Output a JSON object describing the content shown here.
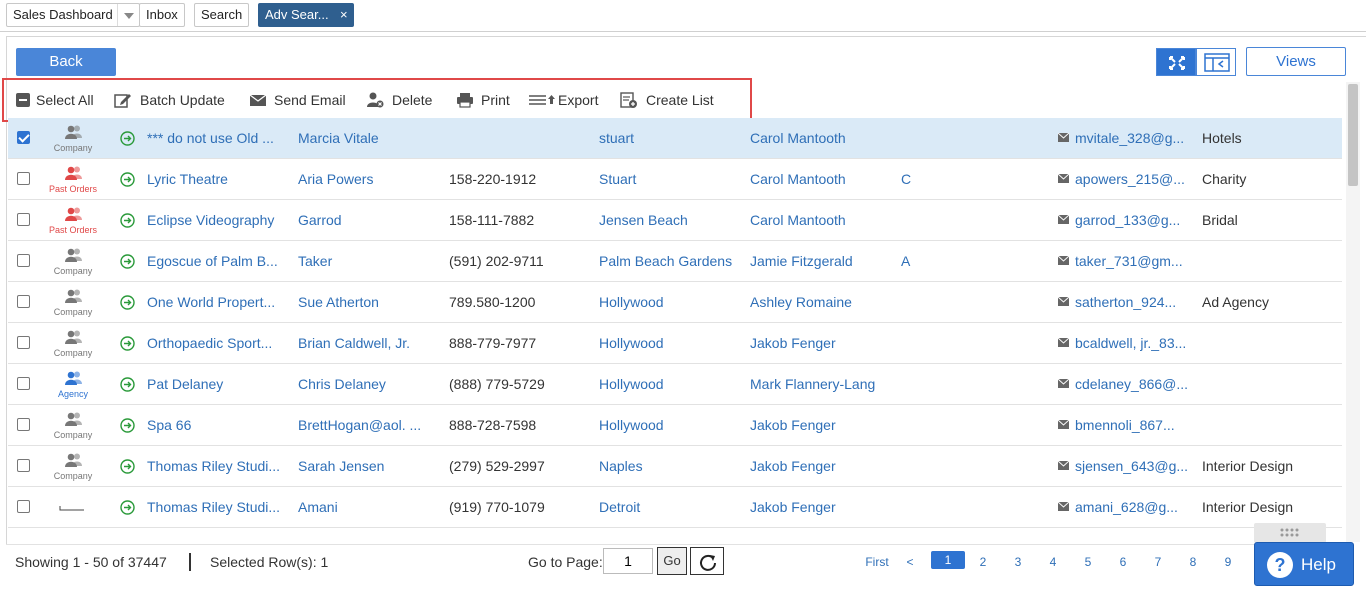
{
  "tabs": [
    {
      "label": "Sales Dashboard"
    },
    {
      "label": "Inbox"
    },
    {
      "label": "Search"
    },
    {
      "label": "Adv Sear...",
      "close": "×"
    }
  ],
  "header": {
    "back_label": "Back",
    "views_label": "Views"
  },
  "toolbar": {
    "select_all": "Select All",
    "batch_update": "Batch Update",
    "send_email": "Send Email",
    "delete": "Delete",
    "print": "Print",
    "export": "Export",
    "create_list": "Create List"
  },
  "colors": {
    "accent": "#2e73d1",
    "company": "#777777",
    "past_orders": "#e04848",
    "agency": "#2e73d1",
    "go_arrow": "#2a9a3a",
    "highlight": "#e04848",
    "selected_row": "#daeaf7"
  },
  "rows": [
    {
      "selected": true,
      "type": "Company",
      "account": "*** do not use Old ...",
      "contact": "Marcia Vitale",
      "phone": "",
      "city": "stuart",
      "rep": "Carol Mantooth",
      "grade": "",
      "email": "mvitale_328@g...",
      "industry": "Hotels"
    },
    {
      "selected": false,
      "type": "Past Orders",
      "account": "Lyric Theatre",
      "contact": "Aria Powers",
      "phone": "158-220-1912",
      "city": "Stuart",
      "rep": "Carol Mantooth",
      "grade": "C",
      "email": "apowers_215@...",
      "industry": "Charity"
    },
    {
      "selected": false,
      "type": "Past Orders",
      "account": "Eclipse Videography",
      "contact": "Garrod",
      "phone": "158-111-7882",
      "city": "Jensen Beach",
      "rep": "Carol Mantooth",
      "grade": "",
      "email": "garrod_133@g...",
      "industry": "Bridal"
    },
    {
      "selected": false,
      "type": "Company",
      "account": "Egoscue of Palm B...",
      "contact": "Taker",
      "phone": "(591) 202-9711",
      "city": "Palm Beach Gardens",
      "rep": "Jamie Fitzgerald",
      "grade": "A",
      "email": "taker_731@gm...",
      "industry": ""
    },
    {
      "selected": false,
      "type": "Company",
      "account": "One World Propert...",
      "contact": "Sue Atherton",
      "phone": "789.580-1200",
      "city": "Hollywood",
      "rep": "Ashley Romaine",
      "grade": "",
      "email": "satherton_924...",
      "industry": "Ad Agency"
    },
    {
      "selected": false,
      "type": "Company",
      "account": "Orthopaedic Sport...",
      "contact": "Brian Caldwell, Jr.",
      "phone": "888-779-7977",
      "city": "Hollywood",
      "rep": "Jakob Fenger",
      "grade": "",
      "email": "bcaldwell, jr._83...",
      "industry": ""
    },
    {
      "selected": false,
      "type": "Agency",
      "account": "Pat Delaney",
      "contact": "Chris Delaney",
      "phone": "(888) 779-5729",
      "city": "Hollywood",
      "rep": "Mark Flannery-Lang",
      "grade": "",
      "email": "cdelaney_866@...",
      "industry": ""
    },
    {
      "selected": false,
      "type": "Company",
      "account": "Spa 66",
      "contact": "BrettHogan@aol. ...",
      "phone": "888-728-7598",
      "city": "Hollywood",
      "rep": "Jakob Fenger",
      "grade": "",
      "email": "bmennoli_867...",
      "industry": ""
    },
    {
      "selected": false,
      "type": "Company",
      "account": "Thomas Riley Studi...",
      "contact": "Sarah Jensen",
      "phone": "(279) 529-2997",
      "city": "Naples",
      "rep": "Jakob Fenger",
      "grade": "",
      "email": "sjensen_643@g...",
      "industry": "Interior Design"
    },
    {
      "selected": false,
      "type": "",
      "account": "Thomas Riley Studi...",
      "contact": "Amani",
      "phone": "(919) 770-1079",
      "city": "Detroit",
      "rep": "Jakob Fenger",
      "grade": "",
      "email": "amani_628@g...",
      "industry": "Interior Design"
    }
  ],
  "footer": {
    "showing": "Showing 1 - 50 of 37447",
    "selected": "Selected Row(s): 1",
    "goto_label": "Go to Page:",
    "page_value": "1",
    "go_label": "Go",
    "first_label": "First",
    "prev_label": "<",
    "pages": [
      "1",
      "2",
      "3",
      "4",
      "5",
      "6",
      "7",
      "8",
      "9"
    ]
  },
  "help": {
    "label": "Help",
    "icon_text": "?"
  }
}
